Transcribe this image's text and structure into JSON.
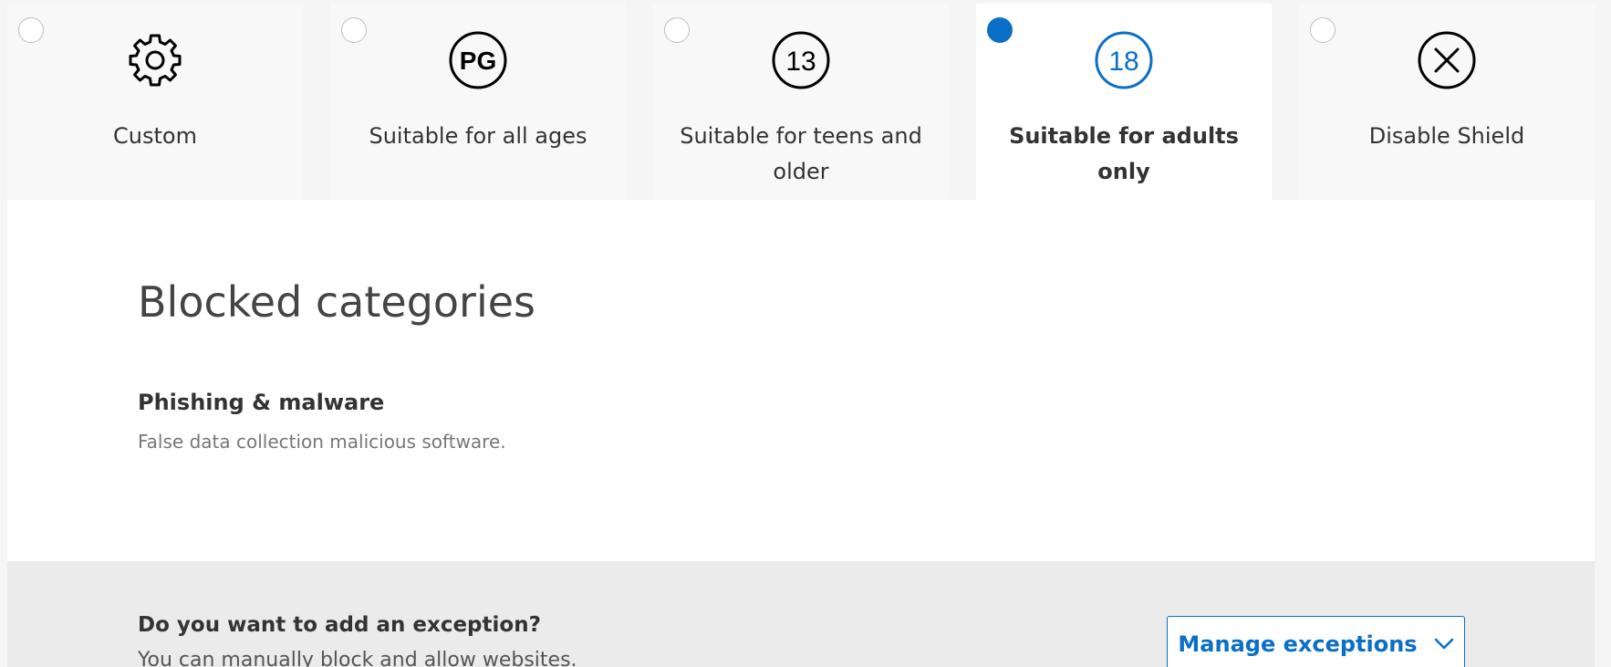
{
  "options": [
    {
      "label": "Custom",
      "icon": "gear-icon",
      "selected": false
    },
    {
      "label": "Suitable for all ages",
      "icon": "pg-rating-icon",
      "icon_text": "PG",
      "selected": false
    },
    {
      "label": "Suitable for teens and older",
      "icon": "rating-13-icon",
      "icon_text": "13",
      "selected": false
    },
    {
      "label": "Suitable for adults only",
      "icon": "rating-18-icon",
      "icon_text": "18",
      "selected": true
    },
    {
      "label": "Disable Shield",
      "icon": "close-circle-icon",
      "selected": false
    }
  ],
  "blocked": {
    "title": "Blocked categories",
    "categories": [
      {
        "name": "Phishing & malware",
        "description": "False data collection malicious software."
      }
    ]
  },
  "exception": {
    "title": "Do you want to add an exception?",
    "description": "You can manually block and allow websites.",
    "button_label": "Manage exceptions"
  },
  "colors": {
    "accent": "#0a6fc7",
    "icon_default": "#000000"
  }
}
